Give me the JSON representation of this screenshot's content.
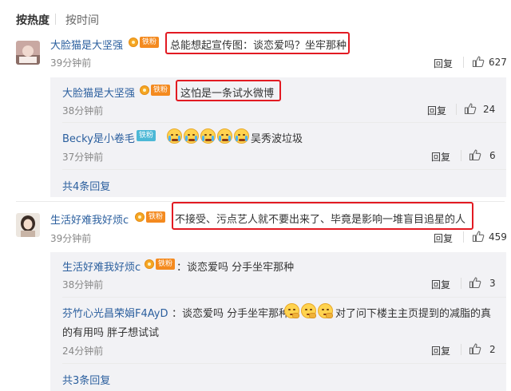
{
  "sort": {
    "hot": "按热度",
    "time": "按时间"
  },
  "c1": {
    "name": "大脸猫是大坚强",
    "badge": "铁粉",
    "text": "总能想起宣传图：谈恋爱吗？坐牢那种",
    "time": "39分钟前",
    "reply": "回复",
    "likes": "627",
    "replies": [
      {
        "name": "大脸猫是大坚强",
        "badge": "铁粉",
        "text": "这怕是一条试水微博",
        "time": "38分钟前",
        "reply": "回复",
        "likes": "24"
      },
      {
        "name": "Becky是小卷毛",
        "badge": "铁粉",
        "text": "吴秀波垃圾",
        "time": "37分钟前",
        "reply": "回复",
        "likes": "6"
      }
    ],
    "more": "共4条回复"
  },
  "c2": {
    "name": "生活好难我好烦c",
    "badge": "铁粉",
    "text": "不接受、污点艺人就不要出来了、毕竟是影响一堆盲目追星的人",
    "time": "39分钟前",
    "reply": "回复",
    "likes": "459",
    "replies": [
      {
        "name": "生活好难我好烦c",
        "badge": "铁粉",
        "text": "：谈恋爱吗 分手坐牢那种",
        "time": "38分钟前",
        "reply": "回复",
        "likes": "3"
      },
      {
        "name": "芬竹心光昌荣娟F4AyD",
        "text_a": "：谈恋爱吗 分手坐牢那种",
        "text_b": "对了问下楼主主页提到的减脂的真",
        "text_c": "的有用吗 胖子想试试",
        "time": "24分钟前",
        "reply": "回复",
        "likes": "2"
      }
    ],
    "more": "共3条回复"
  },
  "icons": {
    "like": "thumbs-up-icon",
    "fan_badge": "fan-badge-icon",
    "emoji_cry": "crying-emoji-icon",
    "emoji_smirk": "smirk-emoji-icon"
  },
  "colors": {
    "link": "#2b5f9e",
    "highlight": "#e21a22",
    "badge_orange": "#f48a1f",
    "badge_teal": "#4cb8d6"
  }
}
